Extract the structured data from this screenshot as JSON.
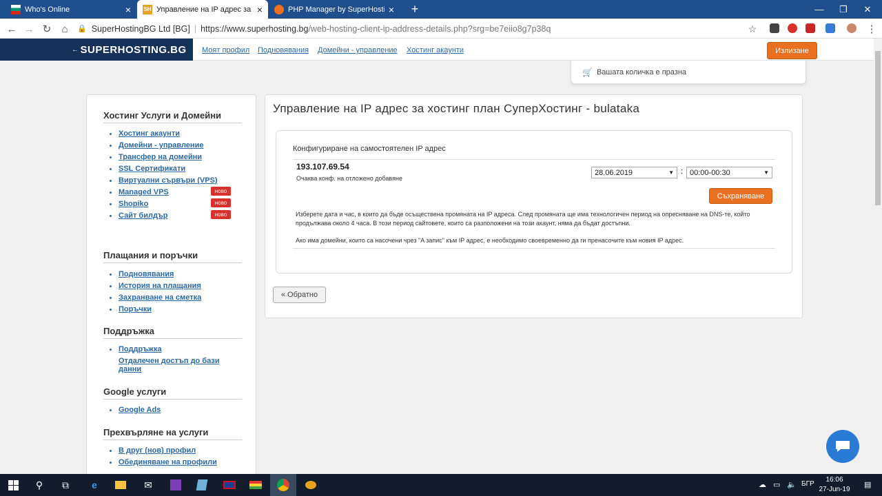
{
  "browser": {
    "tabs": [
      {
        "title": "Who's Online",
        "icon": "bulgarian-flag-icon"
      },
      {
        "title": "Управление на IP адрес за хост",
        "icon": "superhosting-favicon"
      },
      {
        "title": "PHP Manager by SuperHosting",
        "icon": "superhosting-logo-icon"
      }
    ],
    "site_identity": "SuperHostingBG Ltd [BG]",
    "url_base": "https://www.superhosting.bg",
    "url_path": "/web-hosting-client-ip-address-details.php?srg=be7eiio8g7p38q"
  },
  "header": {
    "logo": "SUPERHOSTING.BG",
    "nav": [
      "Моят профил",
      "Подновявания",
      "Домейни - управление",
      "Хостинг акаунти"
    ],
    "logout": "Излизане",
    "cart": "Вашата количка е празна"
  },
  "sidebar": {
    "sections": [
      {
        "title": "Хостинг Услуги и Домейни",
        "items": [
          "Хостинг акаунти",
          "Домейни - управление",
          "Трансфер на домейни",
          "SSL Сертификати",
          "Виртуални сървъри (VPS)",
          "Managed VPS",
          "Shopiko",
          "Сайт билдър"
        ]
      },
      {
        "title": "Плащания и поръчки",
        "items": [
          "Подновявания",
          "История на плащания",
          "Захранване на сметка",
          "Поръчки"
        ]
      },
      {
        "title": "Поддръжка",
        "items": [
          "Поддръжка",
          "Отдалечен достъп до бази данни"
        ]
      },
      {
        "title": "Google услуги",
        "items": [
          "Google Ads"
        ]
      },
      {
        "title": "Прехвърляне на услуги",
        "items": [
          "В друг (нов) профил",
          "Обединяване на профили"
        ]
      }
    ],
    "new_badge": "ново"
  },
  "main": {
    "title": "Управление на IP адрес за хостинг план СуперХостинг - bulataka",
    "config_label": "Конфигуриране на самостоятелен IP адрес",
    "ip": "193.107.69.54",
    "pending": "Очаква конф. на отложено добавяне",
    "date_value": "28.06.2019",
    "time_value": "00:00-00:30",
    "colon": ":",
    "save": "Съхраняване",
    "info1": "Изберете дата и час, в които да бъде осъществена промяната на IP адреса. След промяната ще има технологичен период на опресняване на DNS-те, който продължава около 4 часа. В този период сайтовете, които са разположени на този акаунт, няма да бъдат достъпни.",
    "info2": "Ако има домейни, които са насочени чрез \"A запис\" към IP адрес, е необходимо своевременно да ги пренасочите към новия IP адрес.",
    "back": "« Обратно"
  },
  "taskbar": {
    "lang": "БГР",
    "time": "16:06",
    "date": "27-Jun-19"
  },
  "colors": {
    "tabstrip": "#1f4e8c",
    "logo_bg": "#14315a",
    "accent_orange": "#e8701e",
    "link_blue": "#2a6aa8",
    "badge_red": "#d9302c"
  }
}
